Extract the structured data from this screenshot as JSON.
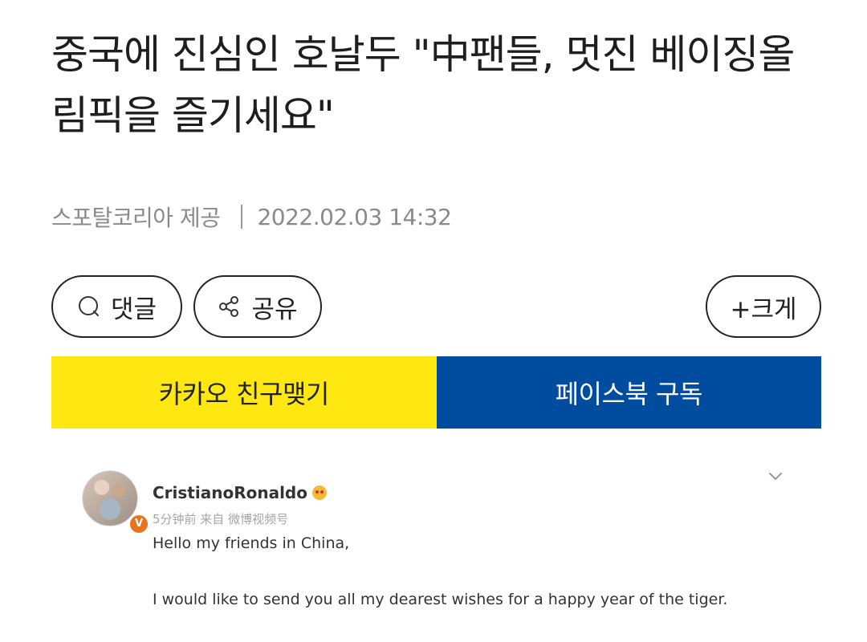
{
  "article": {
    "headline": "중국에 진심인 호날두 \"中팬들, 멋진 베이징올림픽을 즐기세요\"",
    "source": "스포탈코리아 제공",
    "timestamp": "2022.02.03 14:32"
  },
  "actions": {
    "comment_label": "댓글",
    "share_label": "공유",
    "font_size_label": "+크게"
  },
  "subscribe": {
    "kakao_label": "카카오 친구맺기",
    "facebook_label": "페이스북 구독",
    "kakao_color": "#ffe812",
    "facebook_color": "#004c9e"
  },
  "embed": {
    "username": "CristianoRonaldo",
    "post_meta": "5分钟前 来自 微博视频号",
    "lines": [
      "Hello my friends in China,",
      "I would like to send you all my dearest wishes for a happy year of the tiger."
    ],
    "verify_icon": "verified-badge-icon",
    "menu_icon": "chevron-down-icon"
  }
}
